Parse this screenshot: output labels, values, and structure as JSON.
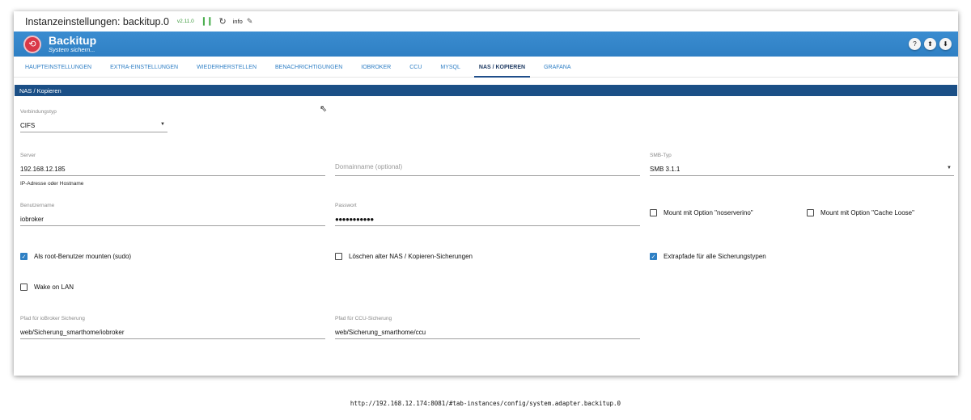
{
  "titlebar": {
    "title": "Instanzeinstellungen: backitup.0",
    "version": "v2.11.0",
    "info_label": "info"
  },
  "header": {
    "name": "Backitup",
    "subtitle": "System sichern..."
  },
  "tabs": [
    {
      "label": "HAUPTEINSTELLUNGEN",
      "active": false
    },
    {
      "label": "EXTRA-EINSTELLUNGEN",
      "active": false
    },
    {
      "label": "WIEDERHERSTELLEN",
      "active": false
    },
    {
      "label": "BENACHRICHTIGUNGEN",
      "active": false
    },
    {
      "label": "IOBROKER",
      "active": false
    },
    {
      "label": "CCU",
      "active": false
    },
    {
      "label": "MYSQL",
      "active": false
    },
    {
      "label": "NAS / KOPIEREN",
      "active": true
    },
    {
      "label": "GRAFANA",
      "active": false
    }
  ],
  "section_title": "NAS / Kopieren",
  "form": {
    "connection": {
      "label": "Verbindungstyp",
      "value": "CIFS"
    },
    "server": {
      "label": "Server",
      "value": "192.168.12.185",
      "helper": "IP-Adresse oder Hostname"
    },
    "domain": {
      "placeholder": "Domainname (optional)"
    },
    "smb": {
      "label": "SMB-Typ",
      "value": "SMB 3.1.1"
    },
    "username": {
      "label": "Benutzername",
      "value": "iobroker"
    },
    "password": {
      "label": "Passwort",
      "value": "●●●●●●●●●●●"
    },
    "cb_noserverino": {
      "label": "Mount mit Option \"noserverino\"",
      "checked": false
    },
    "cb_cacheloose": {
      "label": "Mount mit Option \"Cache Loose\"",
      "checked": false
    },
    "cb_sudo": {
      "label": "Als root-Benutzer mounten (sudo)",
      "checked": true
    },
    "cb_delete": {
      "label": "Löschen alter NAS / Kopieren-Sicherungen",
      "checked": false
    },
    "cb_extra": {
      "label": "Extrapfade für alle Sicherungstypen",
      "checked": true
    },
    "cb_wol": {
      "label": "Wake on LAN",
      "checked": false
    },
    "path_iobroker": {
      "label": "Pfad für ioBroker Sicherung",
      "value": "web/Sicherung_smarthome/iobroker"
    },
    "path_ccu": {
      "label": "Pfad für CCU-Sicherung",
      "value": "web/Sicherung_smarthome/ccu"
    }
  },
  "url": "http://192.168.12.174:8081/#tab-instances/config/system.adapter.backitup.0"
}
